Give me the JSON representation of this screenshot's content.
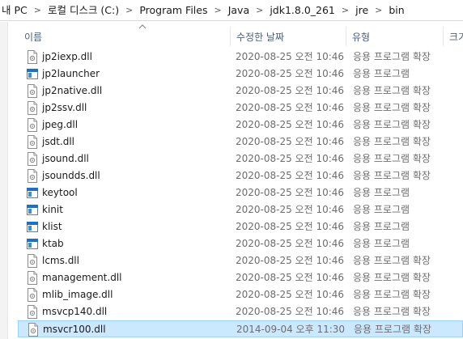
{
  "breadcrumb": [
    "내 PC",
    "로컬 디스크 (C:)",
    "Program Files",
    "Java",
    "jdk1.8.0_261",
    "jre",
    "bin"
  ],
  "columns": {
    "name": "이름",
    "date": "수정한 날짜",
    "type": "유형",
    "size": "크기"
  },
  "files": [
    {
      "name": "jp2iexp.dll",
      "date": "2020-08-25 오전 10:46",
      "type": "응용 프로그램 확장",
      "icon": "dll-file-icon"
    },
    {
      "name": "jp2launcher",
      "date": "2020-08-25 오전 10:46",
      "type": "응용 프로그램",
      "icon": "application-icon"
    },
    {
      "name": "jp2native.dll",
      "date": "2020-08-25 오전 10:46",
      "type": "응용 프로그램 확장",
      "icon": "dll-file-icon"
    },
    {
      "name": "jp2ssv.dll",
      "date": "2020-08-25 오전 10:46",
      "type": "응용 프로그램 확장",
      "icon": "dll-file-icon"
    },
    {
      "name": "jpeg.dll",
      "date": "2020-08-25 오전 10:46",
      "type": "응용 프로그램 확장",
      "icon": "dll-file-icon"
    },
    {
      "name": "jsdt.dll",
      "date": "2020-08-25 오전 10:46",
      "type": "응용 프로그램 확장",
      "icon": "dll-file-icon"
    },
    {
      "name": "jsound.dll",
      "date": "2020-08-25 오전 10:46",
      "type": "응용 프로그램 확장",
      "icon": "dll-file-icon"
    },
    {
      "name": "jsoundds.dll",
      "date": "2020-08-25 오전 10:46",
      "type": "응용 프로그램 확장",
      "icon": "dll-file-icon"
    },
    {
      "name": "keytool",
      "date": "2020-08-25 오전 10:46",
      "type": "응용 프로그램",
      "icon": "application-icon"
    },
    {
      "name": "kinit",
      "date": "2020-08-25 오전 10:46",
      "type": "응용 프로그램",
      "icon": "application-icon"
    },
    {
      "name": "klist",
      "date": "2020-08-25 오전 10:46",
      "type": "응용 프로그램",
      "icon": "application-icon"
    },
    {
      "name": "ktab",
      "date": "2020-08-25 오전 10:46",
      "type": "응용 프로그램",
      "icon": "application-icon"
    },
    {
      "name": "lcms.dll",
      "date": "2020-08-25 오전 10:46",
      "type": "응용 프로그램 확장",
      "icon": "dll-file-icon"
    },
    {
      "name": "management.dll",
      "date": "2020-08-25 오전 10:46",
      "type": "응용 프로그램 확장",
      "icon": "dll-file-icon"
    },
    {
      "name": "mlib_image.dll",
      "date": "2020-08-25 오전 10:46",
      "type": "응용 프로그램 확장",
      "icon": "dll-file-icon"
    },
    {
      "name": "msvcp140.dll",
      "date": "2020-08-25 오전 10:46",
      "type": "응용 프로그램 확장",
      "icon": "dll-file-icon"
    },
    {
      "name": "msvcr100.dll",
      "date": "2014-09-04 오후 11:30",
      "type": "응용 프로그램 확장",
      "icon": "dll-file-icon",
      "selected": true
    }
  ],
  "colors": {
    "selection_bg": "#cce8ff",
    "selection_border": "#99d1ff",
    "header_text": "#4c607a",
    "app_icon_blue": "#1f6fc6"
  }
}
